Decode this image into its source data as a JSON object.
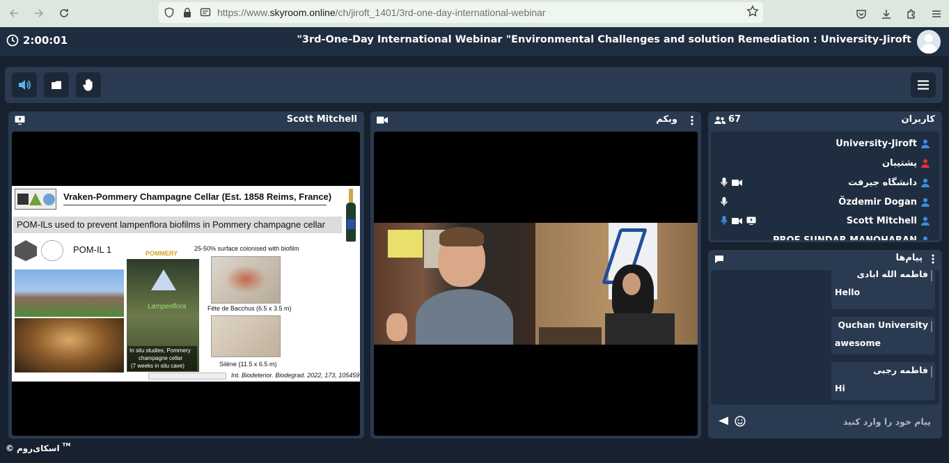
{
  "browser": {
    "url_prefix": "https://www.",
    "url_domain": "skyroom.online",
    "url_path": "/ch/jiroft_1401/3rd-one-day-international-webinar"
  },
  "header": {
    "timer": "2:00:01",
    "title": "\"3rd-One-Day International Webinar \"Environmental Challenges and solution Remediation : University-Jiroft"
  },
  "screen_panel": {
    "title": "Scott Mitchell"
  },
  "slide": {
    "heading": "Vraken-Pommery Champagne Cellar (Est. 1858 Reims, France)",
    "subheading": "POM-ILs used to prevent lampenflora biofilms in Pommery champagne cellar",
    "compound_label": "POM-IL 1",
    "brand": "POMMERY",
    "surface_note": "25-50% surface colonised with biofilm",
    "lampenflora_label": "Lampenflora",
    "caption_1": "Fête de Bacchus (6.5 x 3.5 m)",
    "caption_2": "Silène (11.5 x 6.5 m)",
    "insitu_note_1": "In situ studies, Pommery",
    "insitu_note_2": "champagne cellar",
    "insitu_note_3": "(7 weeks in situ cave)",
    "citation": "Int. Biodeterior. Biodegrad. 2022, 173, 105459"
  },
  "webcam_panel": {
    "title": "وبکم"
  },
  "users_panel": {
    "title": "کاربران",
    "count": "67",
    "users": [
      {
        "name": "University-Jiroft",
        "color": "#3a8ee8"
      },
      {
        "name": "پشتیبان",
        "color": "#e63232"
      },
      {
        "name": "دانشگاه جیرفت",
        "color": "#3a8ee8"
      },
      {
        "name": "Özdemir Dogan",
        "color": "#3a8ee8"
      },
      {
        "name": "Scott Mitchell",
        "color": "#3a8ee8"
      },
      {
        "name": "PROF SUNDAR MANOHARAN",
        "color": "#3a8ee8"
      }
    ]
  },
  "chat_panel": {
    "title": "پیام‌ها",
    "messages": [
      {
        "sender": "فاطمه الله آبادی",
        "text": "Hello"
      },
      {
        "sender": "Quchan University",
        "text": "awesome"
      },
      {
        "sender": "فاطمه رجبی",
        "text": "Hi"
      }
    ],
    "input_placeholder": "پیام خود را وارد کنید"
  },
  "footer": {
    "brand": "اسکای‌روم",
    "tm": "TM"
  }
}
